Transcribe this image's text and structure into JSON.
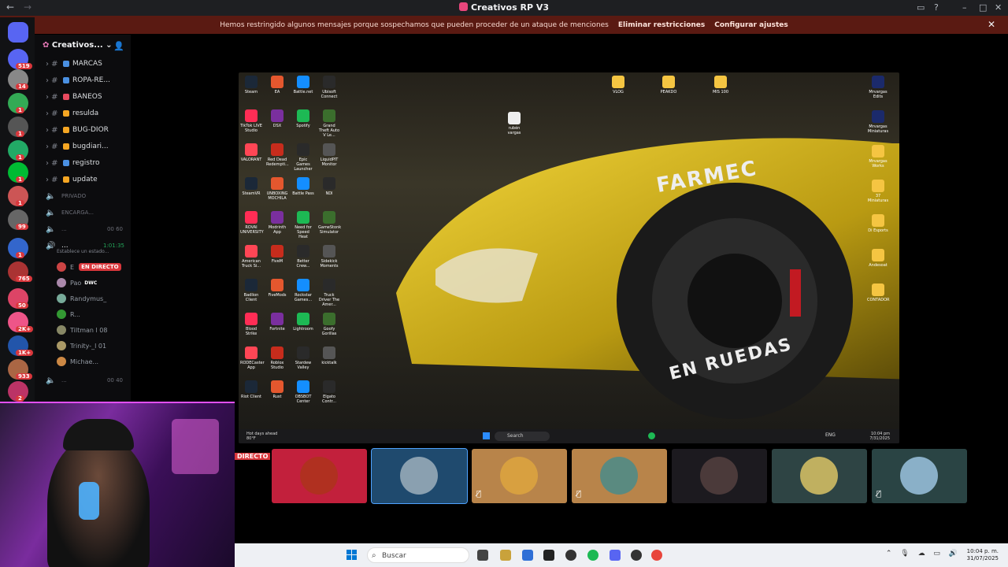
{
  "window": {
    "title": "Creativos RP V3"
  },
  "banner": {
    "message": "Hemos restringido algunos mensajes porque sospechamos que pueden proceder de un ataque de menciones",
    "action1": "Eliminar restricciones",
    "action2": "Configurar ajustes"
  },
  "rail": {
    "badges": [
      "519",
      "14",
      "1",
      "1",
      "1",
      "1",
      "1",
      "99",
      "1",
      "765",
      "50",
      "2K+",
      "1K+",
      "933",
      "2"
    ]
  },
  "server": {
    "name": "Creativos..."
  },
  "channels": [
    {
      "label": "MARCAS",
      "color": "#4a90e2"
    },
    {
      "label": "ROPA-RE...",
      "color": "#4a90e2"
    },
    {
      "label": "BANEOS",
      "color": "#e84a5f"
    },
    {
      "label": "resulda",
      "color": "#f5a623"
    },
    {
      "label": "BUG-DIOR",
      "color": "#f5a623"
    },
    {
      "label": "bugdiari...",
      "color": "#f5a623"
    },
    {
      "label": "registro",
      "color": "#4a90e2"
    },
    {
      "label": "update",
      "color": "#f5a623"
    }
  ],
  "voice_channels": [
    {
      "label": "PRIVADO"
    },
    {
      "label": "ENCARGA..."
    },
    {
      "label": "...",
      "count": "00 60"
    }
  ],
  "active_voice": {
    "label": "...",
    "timer": "1:01:35",
    "status": "Establece un estado..."
  },
  "voice_users": [
    {
      "name": "E",
      "badge": "EN DIRECTO"
    },
    {
      "name": "Pao",
      "tag": "DWC"
    },
    {
      "name": "Randymus_"
    },
    {
      "name": "R..."
    },
    {
      "name": "Tiltman l 08"
    },
    {
      "name": "Trinity-_l 01"
    },
    {
      "name": "Michae..."
    }
  ],
  "voice_bottom": {
    "label": "...",
    "count": "00 40"
  },
  "desktop": {
    "icons": [
      "Steam",
      "EA",
      "Battle.net",
      "Ubisoft Connect",
      "TikTok LIVE Studio",
      "DSX",
      "Spotify",
      "Grand Theft Auto V Le...",
      "VALORANT",
      "Red Dead Redempti...",
      "Epic Games Launcher",
      "LiquidPIT Monitor",
      "SteamVR",
      "UNBOXING MOCHILA",
      "Battle Pass",
      "NDI",
      "ROVAI UNIVERSITY",
      "Modrinth App",
      "Need for Speed Heat",
      "GameStonk Simulator",
      "American Truck Si...",
      "FiveM",
      "Better Crew...",
      "Sidekick Moments",
      "Badlion Client",
      "FiveMods",
      "Rockstar Games...",
      "Truck Driver The Amer...",
      "Blood Strike",
      "Fortnite",
      "Lightroom",
      "Goofy Gorillas",
      "RODECaster App",
      "Roblox Studio",
      "Stardew Valley",
      "kicktalk",
      "Riot Client",
      "Rust",
      "OBSBOT Center",
      "Elgato Contr..."
    ],
    "top_folders": [
      "VLOG",
      "PEAKDO",
      "MIS 100"
    ],
    "right_icons": [
      "Mrvargas Edits",
      "Mrvargas Miniaturas",
      "Mrvargas Works",
      "37 Miniaturas",
      "Di Esports",
      "Andesoat",
      "CONTADOR"
    ],
    "file": "rubén vargas",
    "car_text_top": "FARMEC",
    "car_text_bottom": "EN RUEDAS",
    "taskbar_search": "Search",
    "weather": "Hot days ahead",
    "weather_temp": "80°F",
    "tray_lang": "ENG",
    "tray_time": "10:04 pm",
    "tray_date": "7/31/2025"
  },
  "live_label": "DIRECTO",
  "tiles": [
    {
      "bg": "#c2203c",
      "face": "#b03020",
      "muted": false
    },
    {
      "bg": "#1f4a6e",
      "face": "#8aa0b0",
      "muted": false
    },
    {
      "bg": "#b8844a",
      "face": "#d8a040",
      "muted": true
    },
    {
      "bg": "#b8844a",
      "face": "#5a8a80",
      "muted": true
    },
    {
      "bg": "#1c1a1f",
      "face": "#4b3a3a",
      "muted": false
    },
    {
      "bg": "#2e4444",
      "face": "#c0b060",
      "muted": false
    },
    {
      "bg": "#2a4444",
      "face": "#8ab0c8",
      "muted": true
    }
  ],
  "taskbar": {
    "search": "Buscar",
    "time": "10:04 p. m.",
    "date": "31/07/2025"
  }
}
